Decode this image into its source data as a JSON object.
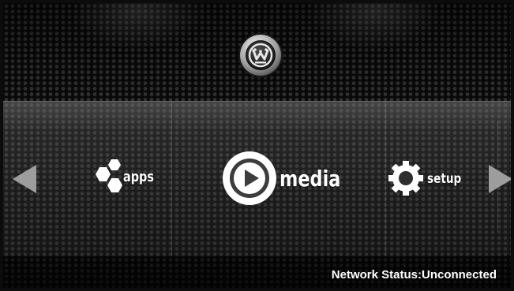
{
  "menu": {
    "items": [
      {
        "label": "apps",
        "icon": "hexagon-cluster-icon"
      },
      {
        "label": "media",
        "icon": "play-circle-icon"
      },
      {
        "label": "setup",
        "icon": "gear-icon"
      }
    ],
    "selected_index": 1
  },
  "navigation": {
    "left_icon": "arrow-left-icon",
    "right_icon": "arrow-right-icon"
  },
  "logo": {
    "icon": "westinghouse-w-logo"
  },
  "status": {
    "text": "Network Status:Unconnected"
  },
  "colors": {
    "text": "#ffffff",
    "arrow": "#9d9d9d",
    "background": "#141414"
  }
}
